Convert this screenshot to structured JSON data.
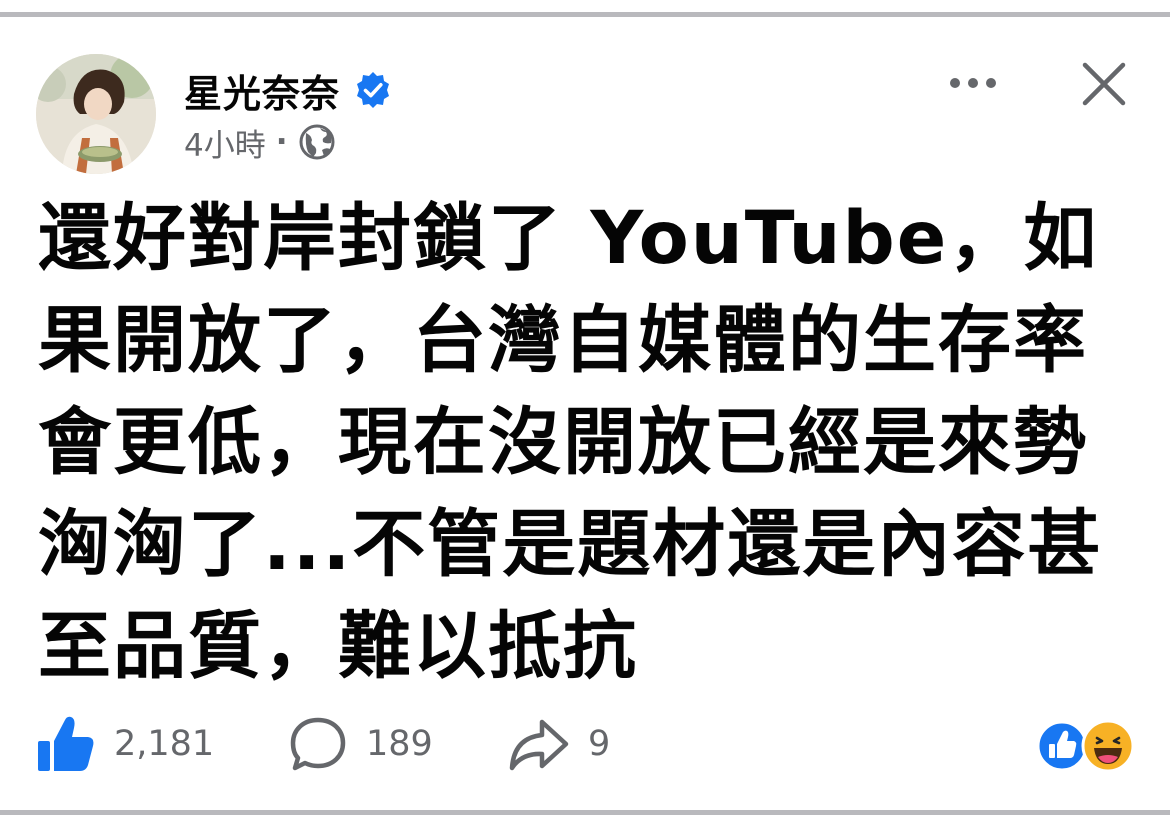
{
  "post": {
    "author": {
      "name": "星光奈奈",
      "verified": true
    },
    "meta": {
      "time": "4小時",
      "separator": "·",
      "audience_icon": "globe-icon"
    },
    "header_actions": {
      "more_icon": "more-dots-icon",
      "close_icon": "close-icon"
    },
    "text": "還好對岸封鎖了 YouTube，如果開放了，台灣自媒體的生存率會更低，現在沒開放已經是來勢洶洶了...不管是題材還是內容甚至品質，難以抵抗",
    "stats": {
      "likes": "2,181",
      "comments": "189",
      "shares": "9"
    },
    "reactions": [
      "like-reaction-icon",
      "haha-reaction-icon"
    ]
  },
  "colors": {
    "facebook_blue": "#1877f2",
    "meta_gray": "#65676b",
    "divider_gray": "#b9b9bd",
    "haha_yellow": "#f7b125"
  }
}
